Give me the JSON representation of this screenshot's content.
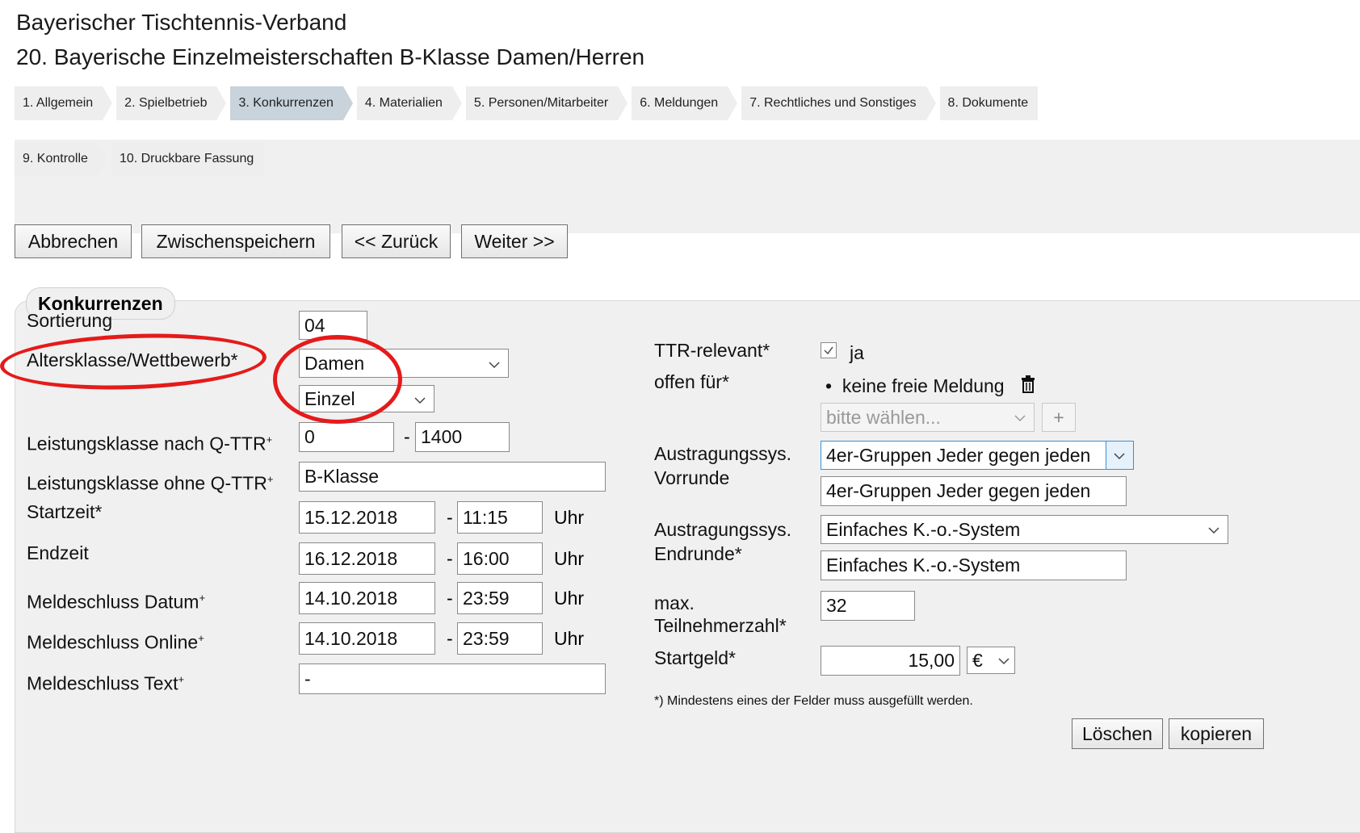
{
  "header": {
    "org": "Bayerischer Tischtennis-Verband",
    "event": "20. Bayerische Einzelmeisterschaften B-Klasse Damen/Herren"
  },
  "steps": [
    {
      "label": "1.  Allgemein",
      "active": false
    },
    {
      "label": "2.  Spielbetrieb",
      "active": false
    },
    {
      "label": "3.  Konkurrenzen",
      "active": true
    },
    {
      "label": "4.  Materialien",
      "active": false
    },
    {
      "label": "5.  Personen/Mitarbeiter",
      "active": false
    },
    {
      "label": "6.  Meldungen",
      "active": false
    },
    {
      "label": "7.  Rechtliches und Sonstiges",
      "active": false
    },
    {
      "label": "8.  Dokumente",
      "active": false
    },
    {
      "label": "9.  Kontrolle",
      "active": false
    },
    {
      "label": "10.  Druckbare Fassung",
      "active": false
    }
  ],
  "toolbar": {
    "cancel": "Abbrechen",
    "save_draft": "Zwischenspeichern",
    "back": "<< Zurück",
    "next": "Weiter >>"
  },
  "section": {
    "legend": "Konkurrenzen"
  },
  "form": {
    "sortierung": {
      "label": "Sortierung",
      "value": "04"
    },
    "altersklasse": {
      "label": "Altersklasse/Wettbewerb*",
      "value1": "Damen",
      "value2": "Einzel"
    },
    "leistung_qttr": {
      "label": "Leistungsklasse nach Q-TTR",
      "mark": "+",
      "from": "0",
      "to": "1400"
    },
    "leistung_ohne": {
      "label": "Leistungsklasse ohne Q-TTR",
      "mark": "+",
      "value": "B-Klasse"
    },
    "startzeit": {
      "label": "Startzeit*",
      "date": "15.12.2018",
      "time": "11:15",
      "unit": "Uhr"
    },
    "endzeit": {
      "label": "Endzeit",
      "date": "16.12.2018",
      "time": "16:00",
      "unit": "Uhr"
    },
    "meldeschluss_datum": {
      "label": "Meldeschluss Datum",
      "mark": "+",
      "date": "14.10.2018",
      "time": "23:59",
      "unit": "Uhr"
    },
    "meldeschluss_online": {
      "label": "Meldeschluss Online",
      "mark": "+",
      "date": "14.10.2018",
      "time": "23:59",
      "unit": "Uhr"
    },
    "meldeschluss_text": {
      "label": "Meldeschluss Text",
      "mark": "+",
      "value": "-"
    },
    "dash": "-",
    "ttr": {
      "label": "TTR-relevant*",
      "checked": true,
      "value": "ja"
    },
    "offen": {
      "label": "offen für*",
      "item": "keine freie Meldung",
      "placeholder": "bitte wählen...",
      "add": "+"
    },
    "vorrunde": {
      "label1": "Austragungssys.",
      "label2": "Vorrunde",
      "select": "4er-Gruppen Jeder gegen jeden",
      "text": "4er-Gruppen Jeder gegen jeden"
    },
    "endrunde": {
      "label1": "Austragungssys.",
      "label2": "Endrunde*",
      "select": "Einfaches K.-o.-System",
      "text": "Einfaches K.-o.-System"
    },
    "max_teilnehmer": {
      "label1": "max.",
      "label2": "Teilnehmerzahl*",
      "value": "32"
    },
    "startgeld": {
      "label": "Startgeld*",
      "value": "15,00",
      "currency": "€"
    },
    "note": "*) Mindestens eines der Felder muss ausgefüllt werden.",
    "delete": "Löschen",
    "copy": "kopieren"
  },
  "colors": {
    "highlight": "#e51a1a",
    "active_step": "#c8d3db",
    "panel": "#f0f0f0",
    "focus": "#3a8fd6"
  },
  "icons": {
    "chevron": "chevron-down-icon",
    "trash": "trash-icon",
    "check": "check-icon"
  }
}
